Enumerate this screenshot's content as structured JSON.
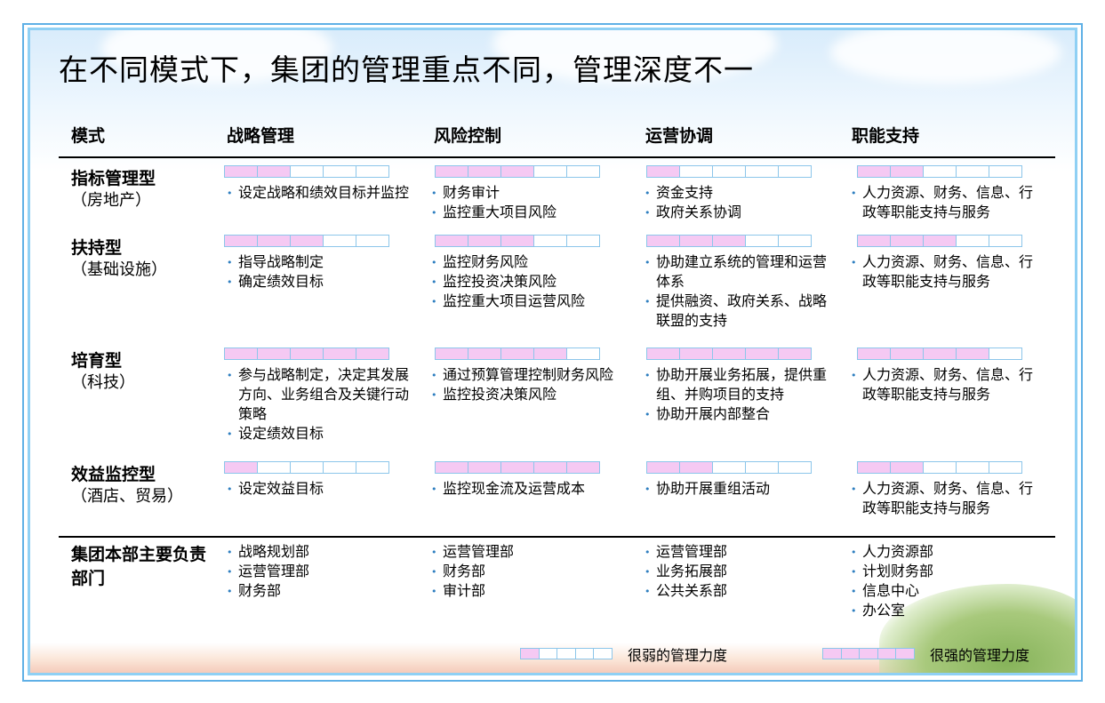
{
  "title": "在不同模式下，集团的管理重点不同，管理深度不一",
  "headers": {
    "mode": "模式",
    "strategy": "战略管理",
    "risk": "风险控制",
    "operation": "运营协调",
    "support": "职能支持"
  },
  "rows": [
    {
      "name": "指标管理型",
      "sub": "（房地产）",
      "levels": [
        2,
        3,
        1,
        2
      ],
      "cells": [
        [
          "设定战略和绩效目标并监控"
        ],
        [
          "财务审计",
          "监控重大项目风险"
        ],
        [
          "资金支持",
          "政府关系协调"
        ],
        [
          "人力资源、财务、信息、行政等职能支持与服务"
        ]
      ]
    },
    {
      "name": "扶持型",
      "sub": "（基础设施）",
      "levels": [
        3,
        3,
        3,
        3
      ],
      "cells": [
        [
          "指导战略制定",
          "确定绩效目标"
        ],
        [
          "监控财务风险",
          "监控投资决策风险",
          "监控重大项目运营风险"
        ],
        [
          "协助建立系统的管理和运营体系",
          "提供融资、政府关系、战略联盟的支持"
        ],
        [
          "人力资源、财务、信息、行政等职能支持与服务"
        ]
      ]
    },
    {
      "name": "培育型",
      "sub": "（科技）",
      "levels": [
        5,
        4,
        5,
        4
      ],
      "cells": [
        [
          "参与战略制定，决定其发展方向、业务组合及关键行动策略",
          "设定绩效目标"
        ],
        [
          "通过预算管理控制财务风险",
          "监控投资决策风险"
        ],
        [
          "协助开展业务拓展，提供重组、并购项目的支持",
          "协助开展内部整合"
        ],
        [
          "人力资源、财务、信息、行政等职能支持与服务"
        ]
      ]
    },
    {
      "name": "效益监控型",
      "sub": "（酒店、贸易）",
      "levels": [
        1,
        5,
        2,
        2
      ],
      "cells": [
        [
          "设定效益目标"
        ],
        [
          "监控现金流及运营成本"
        ],
        [
          "协助开展重组活动"
        ],
        [
          "人力资源、财务、信息、行政等职能支持与服务"
        ]
      ]
    }
  ],
  "departments": {
    "name": "集团本部主要负责部门",
    "cells": [
      [
        "战略规划部",
        "运营管理部",
        "财务部"
      ],
      [
        "运营管理部",
        "财务部",
        "审计部"
      ],
      [
        "运营管理部",
        "业务拓展部",
        "公共关系部"
      ],
      [
        "人力资源部",
        "计划财务部",
        "信息中心",
        "办公室"
      ]
    ]
  },
  "legend": {
    "weak_label": "很弱的管理力度",
    "weak_level": 1,
    "strong_label": "很强的管理力度",
    "strong_level": 5
  },
  "colors": {
    "bar_fill": "#f5c9f3",
    "bar_border": "#8cc6ea",
    "frame_outer": "#5fb0e6",
    "frame_inner": "#8fd0f4",
    "bullet": "#2f7fc0"
  }
}
